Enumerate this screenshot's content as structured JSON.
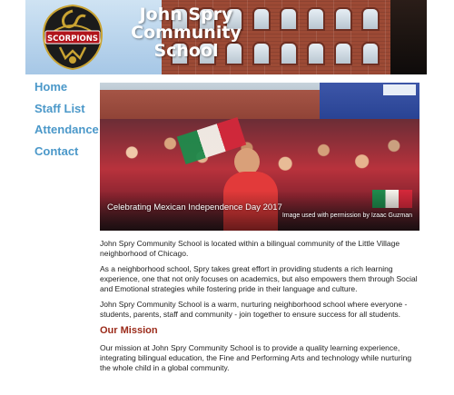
{
  "site": {
    "title_line1": "John Spry",
    "title_line2": "Community",
    "title_line3": "School",
    "logo_text": "SCORPIONS"
  },
  "nav": [
    {
      "label": "Home"
    },
    {
      "label": "Staff List"
    },
    {
      "label": "Attendance"
    },
    {
      "label": "Contact"
    }
  ],
  "hero": {
    "caption": "Celebrating Mexican Independence Day 2017",
    "credit": "Image used with permission by Izaac Guzman"
  },
  "content": {
    "p1": "John Spry Community School is located within a bilingual community of the Little Village neighborhood of Chicago.",
    "p2": "As a neighborhood school, Spry takes great effort in providing students a rich learning experience, one that not only focuses on academics, but also empowers them through Social and Emotional strategies while fostering pride in their language and culture.",
    "p3": "John Spry Community School is a warm, nurturing neighborhood school where everyone - students, parents, staff and community - join together to ensure success for all students.",
    "mission_heading": "Our Mission",
    "mission_text": "Our mission at John Spry Community School is to provide a quality learning experience, integrating bilingual education, the Fine and Performing Arts and technology while nurturing the whole child in a global community."
  },
  "colors": {
    "nav_link": "#4b98c9",
    "mission_heading": "#9b2b1a"
  }
}
